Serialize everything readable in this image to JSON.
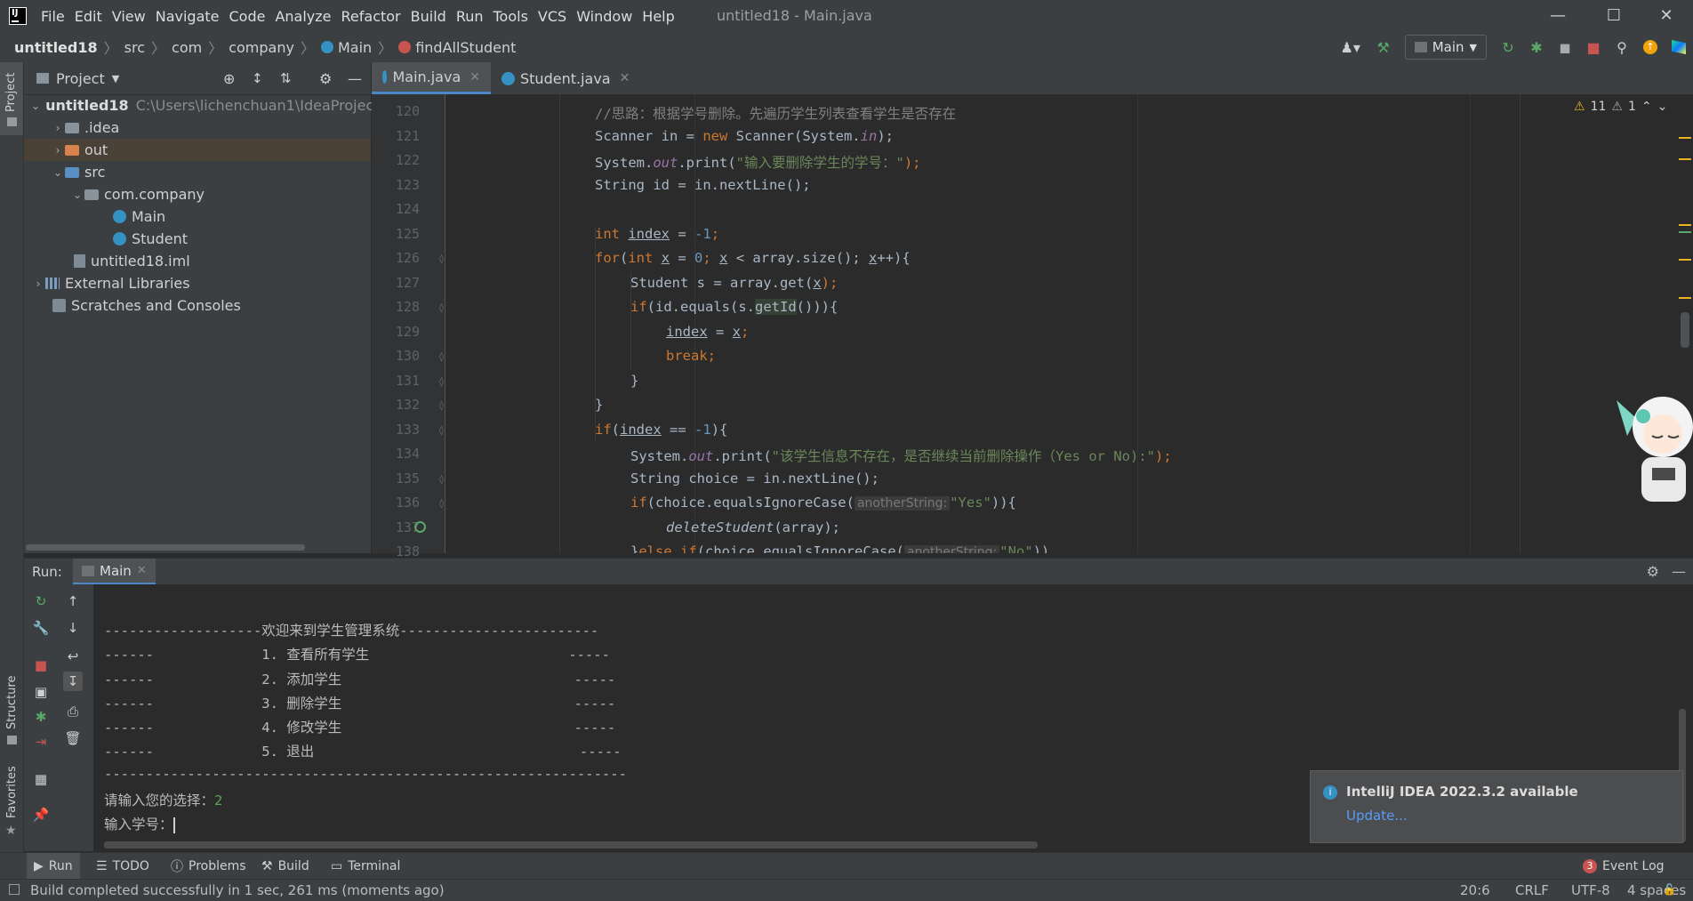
{
  "window": {
    "title": "untitled18 - Main.java",
    "menu": [
      "File",
      "Edit",
      "View",
      "Navigate",
      "Code",
      "Analyze",
      "Refactor",
      "Build",
      "Run",
      "Tools",
      "VCS",
      "Window",
      "Help"
    ]
  },
  "breadcrumb": {
    "project": "untitled18",
    "parts": [
      "src",
      "com",
      "company",
      "Main",
      "findAllStudent"
    ]
  },
  "toolbar": {
    "run_config": "Main"
  },
  "project_panel": {
    "title": "Project",
    "items": [
      {
        "label": "untitled18",
        "extra": "C:\\Users\\lichenchuan1\\IdeaProject"
      },
      {
        "label": ".idea"
      },
      {
        "label": "out"
      },
      {
        "label": "src"
      },
      {
        "label": "com.company"
      },
      {
        "label": "Main"
      },
      {
        "label": "Student"
      },
      {
        "label": "untitled18.iml"
      },
      {
        "label": "External Libraries"
      },
      {
        "label": "Scratches and Consoles"
      }
    ]
  },
  "editor": {
    "tabs": [
      {
        "label": "Main.java",
        "active": true
      },
      {
        "label": "Student.java",
        "active": false
      }
    ],
    "inspections": {
      "warnings": "11",
      "weak_warnings": "1"
    },
    "line_numbers": [
      "120",
      "121",
      "122",
      "123",
      "124",
      "125",
      "126",
      "127",
      "128",
      "129",
      "130",
      "131",
      "132",
      "133",
      "134",
      "135",
      "136",
      "137",
      "138"
    ],
    "code": {
      "l120": "//思路：根据学号删除。先遍历学生列表查看学生是否存在",
      "l121a": "Scanner in = ",
      "l121b": "new",
      "l121c": " Scanner(System.",
      "l121d": "in",
      "l121e": ");",
      "l122a": "System.",
      "l122b": "out",
      "l122c": ".print(",
      "l122d": "\"输入要删除学生的学号：\"",
      "l122e": ");",
      "l123": "String id = in.nextLine();",
      "l125a": "int",
      "l125b": "index",
      "l125c": " = ",
      "l125d": "-1",
      "l125e": ";",
      "l126a": "for",
      "l126b": "(",
      "l126c": "int",
      "l126d": " ",
      "l126e": "x",
      "l126f": " = ",
      "l126g": "0",
      "l126h": "; ",
      "l126i": "x",
      "l126j": " < array.size(); ",
      "l126k": "x",
      "l126l": "++){",
      "l127a": "Student s = array.get(",
      "l127b": "x",
      "l127c": ");",
      "l128a": "if",
      "l128b": "(id.equals(s.",
      "l128c": "getId",
      "l128d": "())){",
      "l129a": "index",
      "l129b": " = ",
      "l129c": "x",
      "l129d": ";",
      "l130a": "break",
      "l130b": ";",
      "l131": "}",
      "l132": "}",
      "l133a": "if",
      "l133b": "(",
      "l133c": "index",
      "l133d": " == ",
      "l133e": "-1",
      "l133f": "){",
      "l134a": "System.",
      "l134b": "out",
      "l134c": ".print(",
      "l134d": "\"该学生信息不存在，是否继续当前删除操作（Yes or No):\"",
      "l134e": ");",
      "l135": "String choice = in.nextLine();",
      "l136a": "if",
      "l136b": "(choice.equalsIgnoreCase(",
      "l136c": "anotherString:",
      "l136d": "\"Yes\"",
      "l136e": ")){",
      "l137a": "deleteStudent",
      "l137b": "(array);",
      "l138a": "}",
      "l138b": "else",
      "l138c": " ",
      "l138d": "if",
      "l138e": "(choice.equalsIgnoreCase(",
      "l138f": "anotherString:",
      "l138g": "\"No\"",
      "l138h": "))"
    }
  },
  "run_panel": {
    "label": "Run:",
    "tab": "Main",
    "console": [
      "-------------------欢迎来到学生管理系统------------------------",
      "------             1. 查看所有学生                        -----",
      "------             2. 添加学生                            -----",
      "------             3. 删除学生                            -----",
      "------             4. 修改学生                            -----",
      "------             5. 退出                                -----",
      "---------------------------------------------------------------"
    ],
    "prompt_choice": "请输入您的选择：",
    "choice_input": "2",
    "prompt_id": "输入学号："
  },
  "notification": {
    "title": "IntelliJ IDEA 2022.3.2 available",
    "link": "Update..."
  },
  "bottom_tools": [
    "Run",
    "TODO",
    "Problems",
    "Build",
    "Terminal"
  ],
  "event_log": {
    "count": "3",
    "label": "Event Log"
  },
  "side_labels": {
    "project": "Project",
    "structure": "Structure",
    "favorites": "Favorites"
  },
  "status": {
    "message": "Build completed successfully in 1 sec, 261 ms (moments ago)",
    "position": "20:6",
    "line_sep": "CRLF",
    "encoding": "UTF-8",
    "indent": "4 spaces"
  },
  "colors": {
    "accent": "#4a88c7",
    "keyword": "#cc7832",
    "string": "#6a8759",
    "number": "#6897bb",
    "field": "#9876aa"
  }
}
